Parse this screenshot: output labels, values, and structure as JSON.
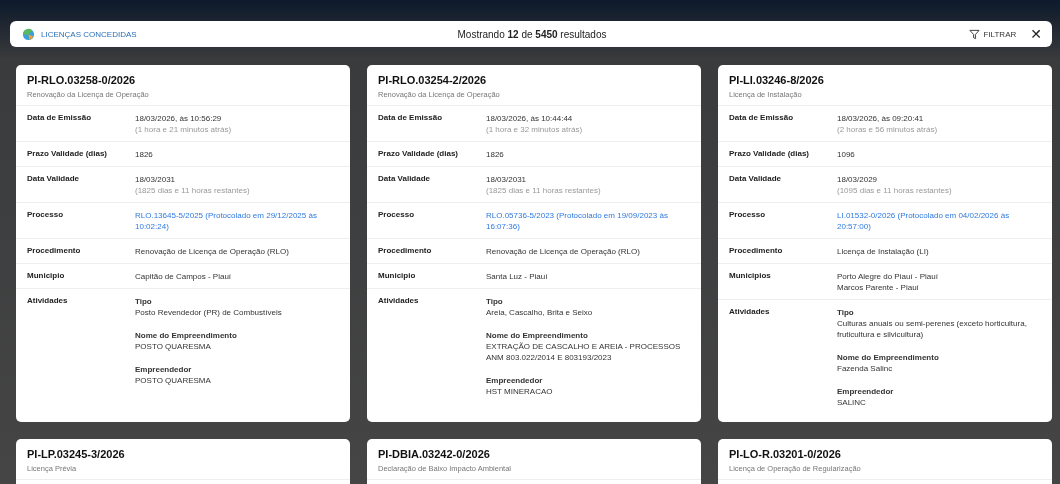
{
  "header": {
    "title": "LICENÇAS CONCEDIDAS",
    "summary": "Mostrando **12** de **5450** resultados",
    "filter_label": "FILTRAR",
    "close": "✕"
  },
  "cards": [
    {
      "code": "PI-RLO.03258-0/2026",
      "type": "Renovação da Licença de Operação",
      "fields": [
        {
          "label": "Data de Emissão",
          "kind": "text",
          "lines": [
            "18/03/2026, às 10:56:29"
          ],
          "note": "(1 hora e 21 minutos atrás)"
        },
        {
          "label": "Prazo Validade (dias)",
          "kind": "text",
          "lines": [
            "1826"
          ]
        },
        {
          "label": "Data Validade",
          "kind": "text",
          "lines": [
            "18/03/2031"
          ],
          "note": "(1825 dias e 11 horas restantes)"
        },
        {
          "label": "Processo",
          "kind": "link",
          "lines": [
            "RLO.13645-5/2025 (Protocolado em 29/12/2025 às 10:02:24)"
          ]
        },
        {
          "label": "Procedimento",
          "kind": "text",
          "lines": [
            "Renovação de Licença de Operação (RLO)"
          ]
        },
        {
          "label": "Municipio",
          "kind": "text",
          "lines": [
            "Capitão de Campos - Piauí"
          ]
        },
        {
          "label": "Atividades",
          "kind": "activities",
          "items": [
            {
              "heading": "Tipo",
              "value": "Posto Revendedor (PR) de Combustíveis"
            },
            {
              "heading": "Nome do Empreendimento",
              "value": "POSTO QUARESMA"
            },
            {
              "heading": "Empreendedor",
              "value": "POSTO QUARESMA"
            }
          ]
        }
      ]
    },
    {
      "code": "PI-RLO.03254-2/2026",
      "type": "Renovação da Licença de Operação",
      "fields": [
        {
          "label": "Data de Emissão",
          "kind": "text",
          "lines": [
            "18/03/2026, às 10:44:44"
          ],
          "note": "(1 hora e 32 minutos atrás)"
        },
        {
          "label": "Prazo Validade (dias)",
          "kind": "text",
          "lines": [
            "1826"
          ]
        },
        {
          "label": "Data Validade",
          "kind": "text",
          "lines": [
            "18/03/2031"
          ],
          "note": "(1825 dias e 11 horas restantes)"
        },
        {
          "label": "Processo",
          "kind": "link",
          "lines": [
            "RLO.05736-5/2023 (Protocolado em 19/09/2023 às 16:07:36)"
          ]
        },
        {
          "label": "Procedimento",
          "kind": "text",
          "lines": [
            "Renovação de Licença de Operação (RLO)"
          ]
        },
        {
          "label": "Municipio",
          "kind": "text",
          "lines": [
            "Santa Luz - Piauí"
          ]
        },
        {
          "label": "Atividades",
          "kind": "activities",
          "items": [
            {
              "heading": "Tipo",
              "value": "Areia, Cascalho, Brita e Seixo"
            },
            {
              "heading": "Nome do Empreendimento",
              "value": "EXTRAÇÃO DE CASCALHO E AREIA - PROCESSOS ANM 803.022/2014 E 803193/2023"
            },
            {
              "heading": "Empreendedor",
              "value": "HST MINERACAO"
            }
          ]
        }
      ]
    },
    {
      "code": "PI-LI.03246-8/2026",
      "type": "Licença de Instalação",
      "fields": [
        {
          "label": "Data de Emissão",
          "kind": "text",
          "lines": [
            "18/03/2026, às 09:20:41"
          ],
          "note": "(2 horas e 56 minutos atrás)"
        },
        {
          "label": "Prazo Validade (dias)",
          "kind": "text",
          "lines": [
            "1096"
          ]
        },
        {
          "label": "Data Validade",
          "kind": "text",
          "lines": [
            "18/03/2029"
          ],
          "note": "(1095 dias e 11 horas restantes)"
        },
        {
          "label": "Processo",
          "kind": "link",
          "lines": [
            "LI.01532-0/2026 (Protocolado em 04/02/2026 às 20:57:00)"
          ]
        },
        {
          "label": "Procedimento",
          "kind": "text",
          "lines": [
            "Licença de Instalação (LI)"
          ]
        },
        {
          "label": "Municipios",
          "kind": "text",
          "lines": [
            "Porto Alegre do Piauí - Piauí",
            "Marcos Parente - Piauí"
          ]
        },
        {
          "label": "Atividades",
          "kind": "activities",
          "items": [
            {
              "heading": "Tipo",
              "value": "Culturas anuais ou semi-perenes (exceto horticultura, fruticultura e silvicultura)"
            },
            {
              "heading": "Nome do Empreendimento",
              "value": "Fazenda Salinc"
            },
            {
              "heading": "Empreendedor",
              "value": "SALINC"
            }
          ]
        }
      ]
    },
    {
      "code": "PI-LP.03245-3/2026",
      "type": "Licença Prévia"
    },
    {
      "code": "PI-DBIA.03242-0/2026",
      "type": "Declaração de Baixo Impacto Ambiental"
    },
    {
      "code": "PI-LO-R.03201-0/2026",
      "type": "Licença de Operação de Regularização"
    }
  ]
}
